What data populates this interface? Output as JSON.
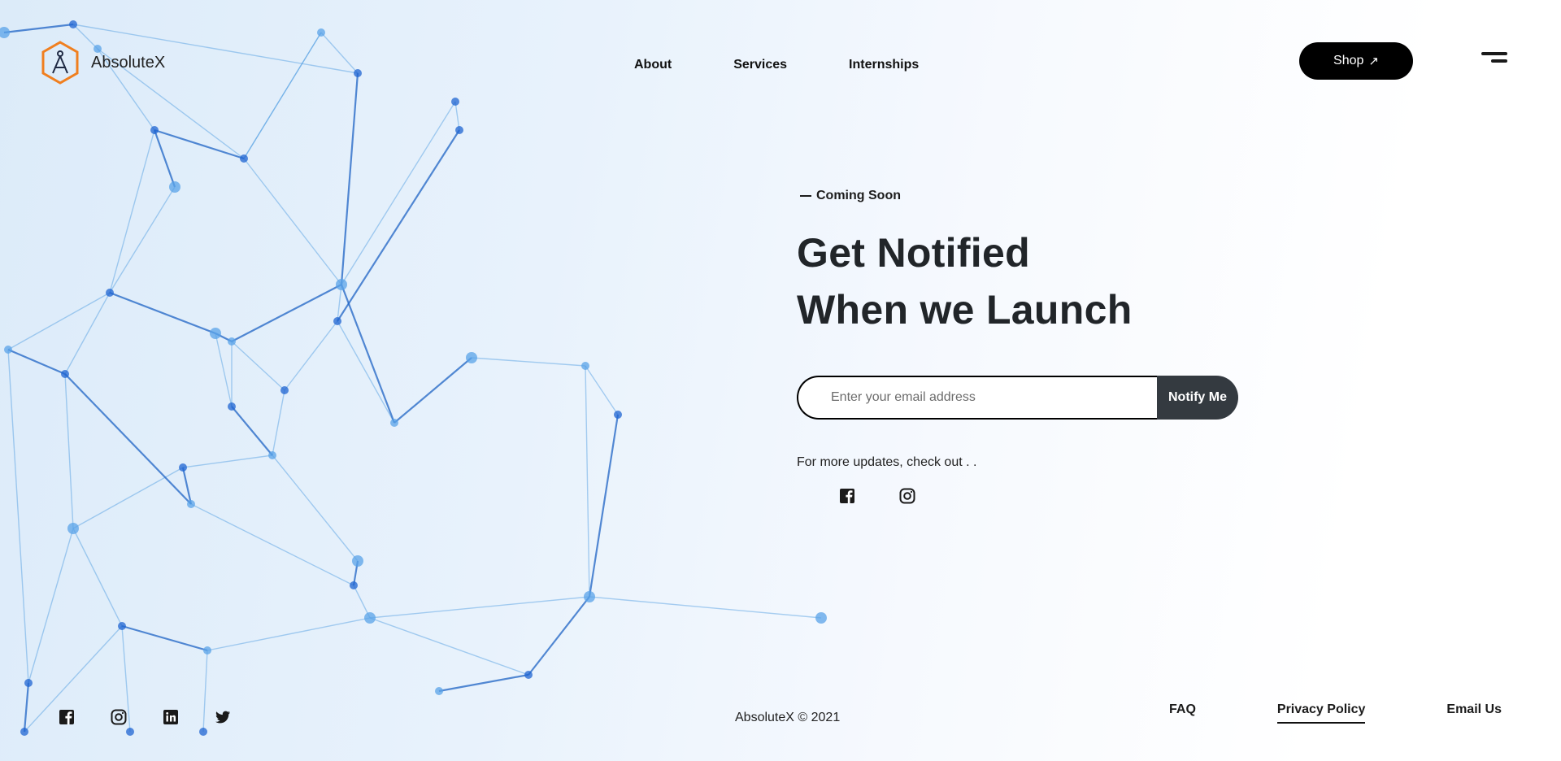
{
  "brand": {
    "name": "AbsoluteX",
    "logo_icon": "compass-hexagon-icon",
    "logo_color": "#f07f1f"
  },
  "nav": {
    "items": [
      {
        "label": "About"
      },
      {
        "label": "Services"
      },
      {
        "label": "Internships"
      }
    ]
  },
  "header": {
    "shop_label": "Shop",
    "shop_arrow": "↗",
    "menu_icon": "menu-icon"
  },
  "hero": {
    "eyebrow": "Coming Soon",
    "headline_line1": "Get Notified",
    "headline_line2": "When we Launch"
  },
  "form": {
    "email_placeholder": "Enter your email address",
    "email_value": "",
    "submit_label": "Notify Me"
  },
  "updates": {
    "text": "For more updates, check out . .",
    "icons": [
      "facebook-icon",
      "instagram-icon"
    ]
  },
  "footer": {
    "social_icons": [
      "facebook-icon",
      "instagram-icon",
      "linkedin-icon",
      "twitter-icon"
    ],
    "copyright": "AbsoluteX © 2021",
    "links": [
      {
        "label": "FAQ"
      },
      {
        "label": "Privacy Policy"
      },
      {
        "label": "Email Us"
      }
    ]
  },
  "colors": {
    "accent_dark": "#343a40",
    "network_blue": "#1e6fd0",
    "text": "#212529"
  }
}
